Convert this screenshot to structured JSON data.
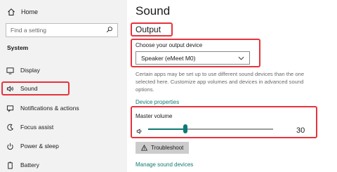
{
  "sidebar": {
    "home_label": "Home",
    "search_placeholder": "Find a setting",
    "section_title": "System",
    "items": [
      {
        "label": "Display",
        "icon": "display-icon"
      },
      {
        "label": "Sound",
        "icon": "speaker-icon",
        "selected": true
      },
      {
        "label": "Notifications & actions",
        "icon": "notifications-icon"
      },
      {
        "label": "Focus assist",
        "icon": "focus-assist-icon"
      },
      {
        "label": "Power & sleep",
        "icon": "power-icon"
      },
      {
        "label": "Battery",
        "icon": "battery-icon"
      }
    ]
  },
  "main": {
    "title": "Sound",
    "output_heading": "Output",
    "choose_device_label": "Choose your output device",
    "selected_device": "Speaker (eMeet M0)",
    "description": "Certain apps may be set up to use different sound devices than the one selected here. Customize app volumes and devices in advanced sound options.",
    "device_properties_link": "Device properties",
    "master_volume_label": "Master volume",
    "volume": 30,
    "troubleshoot_label": "Troubleshoot",
    "manage_devices_link": "Manage sound devices"
  },
  "colors": {
    "accent": "#0f7a74",
    "highlight": "#e5343c",
    "sidebar_bg": "#f2f2f2"
  }
}
